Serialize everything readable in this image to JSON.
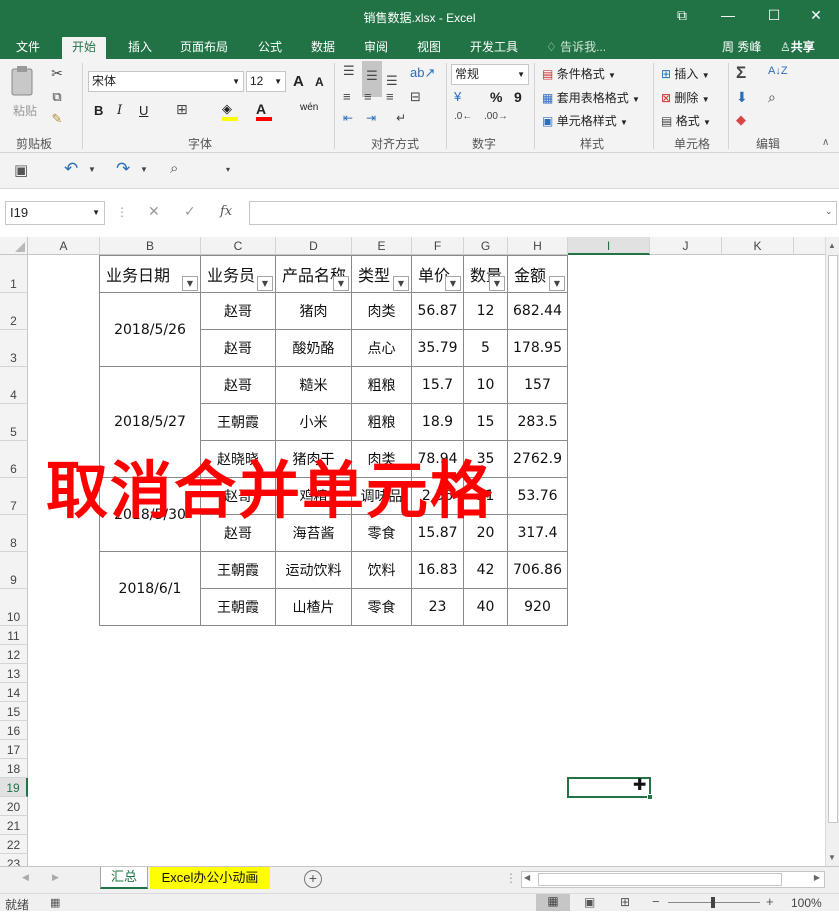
{
  "window": {
    "title": "销售数据.xlsx - Excel",
    "restore_label": "⧉",
    "minimize_label": "—",
    "maximize_label": "☐",
    "close_label": "✕"
  },
  "ribbon_tabs": [
    "文件",
    "开始",
    "插入",
    "页面布局",
    "公式",
    "数据",
    "审阅",
    "视图",
    "开发工具"
  ],
  "tell_me": "告诉我...",
  "user_name": "周 秀峰",
  "share_label": "共享",
  "clipboard": {
    "paste_label": "粘贴",
    "group_label": "剪贴板"
  },
  "font": {
    "name": "宋体",
    "size": "12",
    "group_label": "字体",
    "bold": "B",
    "italic": "I",
    "underline": "U",
    "grow": "A",
    "shrink": "A",
    "phonetic": "wén"
  },
  "alignment": {
    "group_label": "对齐方式"
  },
  "number": {
    "format": "常规",
    "group_label": "数字",
    "percent": "%",
    "comma": "9"
  },
  "styles": {
    "conditional": "条件格式",
    "table": "套用表格格式",
    "cell_styles": "单元格样式",
    "group_label": "样式"
  },
  "cells": {
    "insert": "插入",
    "delete": "删除",
    "format": "格式",
    "group_label": "单元格"
  },
  "editing": {
    "group_label": "编辑"
  },
  "formula_bar": {
    "name_box": "I19",
    "fx": "fx",
    "value": ""
  },
  "columns": [
    "A",
    "B",
    "C",
    "D",
    "E",
    "F",
    "G",
    "H",
    "I",
    "J",
    "K"
  ],
  "selected_column": "I",
  "rows": [
    "1",
    "2",
    "3",
    "4",
    "5",
    "6",
    "7",
    "8",
    "9",
    "10",
    "11",
    "12",
    "13",
    "14",
    "15",
    "16",
    "17",
    "18",
    "19",
    "20",
    "21",
    "22",
    "23"
  ],
  "selected_row": "19",
  "table": {
    "headers": [
      "业务日期",
      "业务员",
      "产品名称",
      "类型",
      "单价",
      "数量",
      "金额"
    ],
    "dates": [
      "2018/5/26",
      "2018/5/27",
      "2018/5/30",
      "2018/6/1"
    ],
    "rows": [
      [
        "赵哥",
        "猪肉",
        "肉类",
        "56.87",
        "12",
        "682.44"
      ],
      [
        "赵哥",
        "酸奶酪",
        "点心",
        "35.79",
        "5",
        "178.95"
      ],
      [
        "赵哥",
        "糙米",
        "粗粮",
        "15.7",
        "10",
        "157"
      ],
      [
        "王朝霞",
        "小米",
        "粗粮",
        "18.9",
        "15",
        "283.5"
      ],
      [
        "赵晓晓",
        "猪肉干",
        "肉类",
        "78.94",
        "35",
        "2762.9"
      ],
      [
        "赵哥",
        "鸡精",
        "调味品",
        "2.56",
        "21",
        "53.76"
      ],
      [
        "赵哥",
        "海苔酱",
        "零食",
        "15.87",
        "20",
        "317.4"
      ],
      [
        "王朝霞",
        "运动饮料",
        "饮料",
        "16.83",
        "42",
        "706.86"
      ],
      [
        "王朝霞",
        "山楂片",
        "零食",
        "23",
        "40",
        "920"
      ]
    ]
  },
  "overlay_text": "取消合并单元格",
  "sheet_tabs": [
    "汇总",
    "Excel办公小动画"
  ],
  "status": {
    "ready": "就绪",
    "zoom": "100%"
  },
  "colors": {
    "accent": "#217346",
    "title_red": "#ff0000",
    "tab_highlight": "#ffff00"
  }
}
